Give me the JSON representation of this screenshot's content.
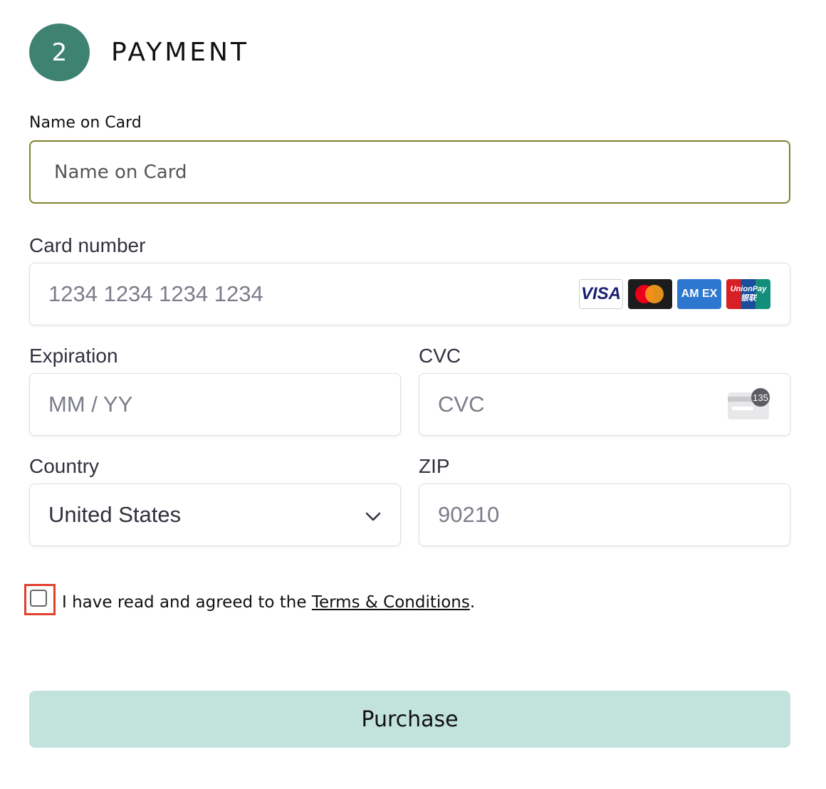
{
  "section": {
    "step_number": "2",
    "title": "PAYMENT"
  },
  "name_on_card": {
    "label": "Name on Card",
    "placeholder": "Name on Card",
    "value": ""
  },
  "card_number": {
    "label": "Card number",
    "placeholder": "1234 1234 1234 1234",
    "value": "",
    "brands": [
      {
        "name": "visa-icon",
        "text": "VISA"
      },
      {
        "name": "mastercard-icon",
        "text": ""
      },
      {
        "name": "amex-icon",
        "text": "AM EX"
      },
      {
        "name": "unionpay-icon",
        "text": "UnionPay 银联"
      }
    ]
  },
  "expiration": {
    "label": "Expiration",
    "placeholder": "MM / YY",
    "value": ""
  },
  "cvc": {
    "label": "CVC",
    "placeholder": "CVC",
    "value": "",
    "icon_badge": "135"
  },
  "country": {
    "label": "Country",
    "selected": "United States"
  },
  "zip": {
    "label": "ZIP",
    "placeholder": "90210",
    "value": ""
  },
  "terms": {
    "checked": false,
    "prefix": "I have read and agreed to the ",
    "link": "Terms & Conditions",
    "suffix": "."
  },
  "purchase_button": {
    "label": "Purchase"
  },
  "colors": {
    "step_circle": "#3e8272",
    "purchase_button_bg": "#c1e3dc",
    "focused_border": "#7f8232",
    "checkbox_highlight": "#e0412c"
  }
}
